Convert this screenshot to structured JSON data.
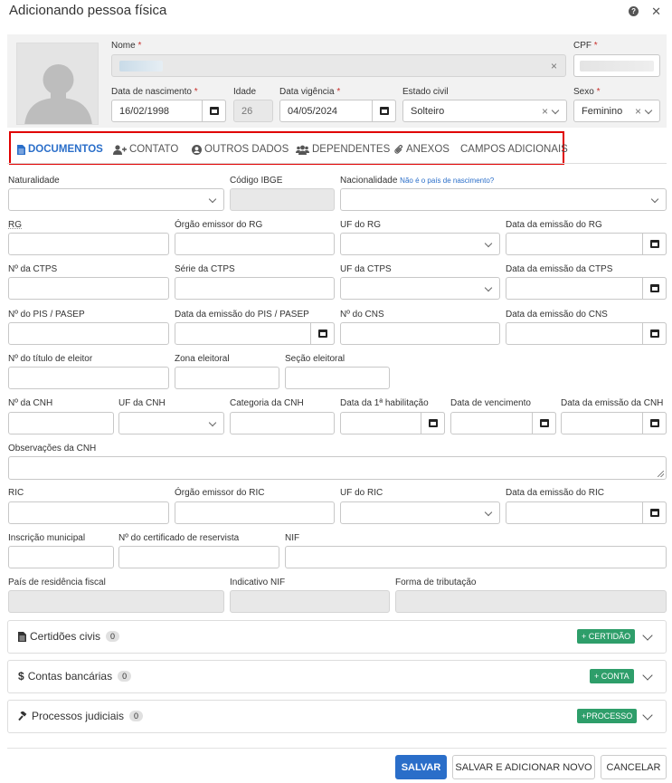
{
  "modal": {
    "title": "Adicionando pessoa física"
  },
  "person": {
    "nome_label": "Nome",
    "cpf_label": "CPF",
    "nascimento_label": "Data de nascimento",
    "nascimento_value": "16/02/1998",
    "idade_label": "Idade",
    "idade_value": "26",
    "vigencia_label": "Data vigência",
    "vigencia_value": "04/05/2024",
    "estado_civil_label": "Estado civil",
    "estado_civil_value": "Solteiro",
    "sexo_label": "Sexo",
    "sexo_value": "Feminino",
    "required_mark": "*"
  },
  "tabs": [
    {
      "label": "DOCUMENTOS",
      "icon": "file-icon"
    },
    {
      "label": "CONTATO",
      "icon": "user-plus-icon"
    },
    {
      "label": "OUTROS DADOS",
      "icon": "user-circle-icon"
    },
    {
      "label": "DEPENDENTES",
      "icon": "users-icon"
    },
    {
      "label": "ANEXOS",
      "icon": "paperclip-icon"
    },
    {
      "label": "CAMPOS ADICIONAIS",
      "icon": ""
    }
  ],
  "fields": {
    "naturalidade": "Naturalidade",
    "codigo_ibge": "Código IBGE",
    "nacionalidade": "Nacionalidade",
    "nacionalidade_link": "Não é o país de nascimento?",
    "rg": "RG",
    "orgao_rg": "Órgão emissor do RG",
    "uf_rg": "UF do RG",
    "emissao_rg": "Data da emissão do RG",
    "ctps": "Nº da CTPS",
    "serie_ctps": "Série da CTPS",
    "uf_ctps": "UF da CTPS",
    "emissao_ctps": "Data da emissão da CTPS",
    "pis": "Nº do PIS / PASEP",
    "emissao_pis": "Data da emissão do PIS / PASEP",
    "cns": "Nº do CNS",
    "emissao_cns": "Data da emissão do CNS",
    "titulo": "Nº do título de eleitor",
    "zona": "Zona eleitoral",
    "secao": "Seção eleitoral",
    "cnh": "Nº da CNH",
    "uf_cnh": "UF da CNH",
    "categoria_cnh": "Categoria da CNH",
    "primeira_hab": "Data da 1ª habilitação",
    "vencimento": "Data de vencimento",
    "emissao_cnh": "Data da emissão da CNH",
    "obs_cnh": "Observações da CNH",
    "ric": "RIC",
    "orgao_ric": "Órgão emissor do RIC",
    "uf_ric": "UF do RIC",
    "emissao_ric": "Data da emissão do RIC",
    "inscricao": "Inscrição municipal",
    "reservista": "Nº do certificado de reservista",
    "nif": "NIF",
    "pais_fiscal": "País de residência fiscal",
    "indicativo_nif": "Indicativo NIF",
    "tributacao": "Forma de tributação"
  },
  "panels": [
    {
      "title": "Certidões civis",
      "count": "0",
      "button": "+ CERTIDÃO",
      "icon": "file-icon"
    },
    {
      "title": "Contas bancárias",
      "count": "0",
      "button": "+ CONTA",
      "icon": "dollar-icon"
    },
    {
      "title": "Processos judiciais",
      "count": "0",
      "button": "+PROCESSO",
      "icon": "gavel-icon"
    }
  ],
  "footer": {
    "save": "SALVAR",
    "save_new": "SALVAR E ADICIONAR NOVO",
    "cancel": "CANCELAR"
  },
  "colors": {
    "primary": "#2a6ec9",
    "success": "#2e9e6a",
    "highlight": "#e00000"
  }
}
